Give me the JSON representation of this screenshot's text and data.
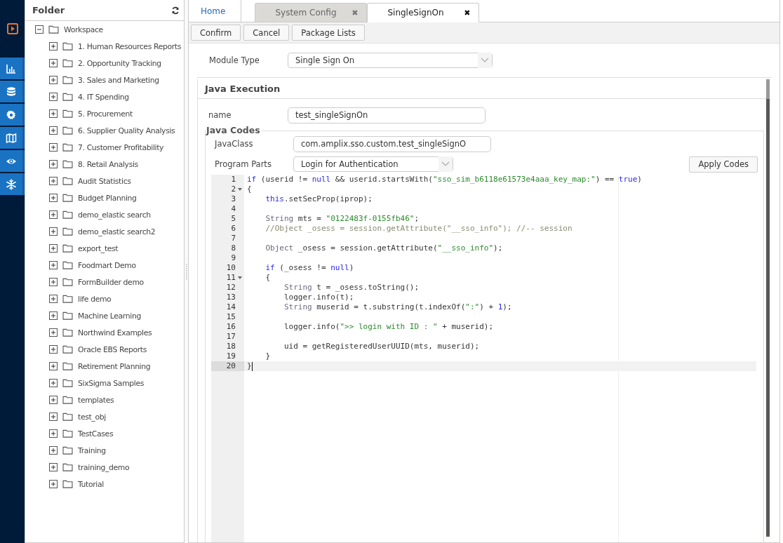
{
  "folder_panel": {
    "title": "Folder",
    "tree": [
      {
        "label": "Workspace",
        "expanded": true,
        "children": [
          {
            "label": "1. Human Resources Reports",
            "expanded": false
          },
          {
            "label": "2. Opportunity Tracking",
            "expanded": false
          },
          {
            "label": "3. Sales and Marketing",
            "expanded": false
          },
          {
            "label": "4. IT Spending",
            "expanded": false
          },
          {
            "label": "5. Procurement",
            "expanded": false
          },
          {
            "label": "6. Supplier Quality Analysis",
            "expanded": false
          },
          {
            "label": "7. Customer Profitability",
            "expanded": false
          },
          {
            "label": "8. Retail Analysis",
            "expanded": false
          },
          {
            "label": "Audit Statistics",
            "expanded": false
          },
          {
            "label": "Budget Planning",
            "expanded": false
          },
          {
            "label": "demo_elastic search",
            "expanded": false
          },
          {
            "label": "demo_elastic search2",
            "expanded": false
          },
          {
            "label": "export_test",
            "expanded": false
          },
          {
            "label": "Foodmart Demo",
            "expanded": false
          },
          {
            "label": "FormBuilder demo",
            "expanded": false
          },
          {
            "label": "life demo",
            "expanded": false
          },
          {
            "label": "Machine Learning",
            "expanded": false
          },
          {
            "label": "Northwind Examples",
            "expanded": false
          },
          {
            "label": "Oracle EBS Reports",
            "expanded": false
          },
          {
            "label": "Retirement Planning",
            "expanded": false
          },
          {
            "label": "SixSigma Samples",
            "expanded": false
          },
          {
            "label": "templates",
            "expanded": false
          },
          {
            "label": "test_obj",
            "expanded": false
          },
          {
            "label": "TestCases",
            "expanded": false
          },
          {
            "label": "Training",
            "expanded": false
          },
          {
            "label": "training_demo",
            "expanded": false
          },
          {
            "label": "Tutorial",
            "expanded": false
          }
        ]
      }
    ]
  },
  "tabs": [
    {
      "label": "Home",
      "kind": "home",
      "selected": false
    },
    {
      "label": "System Config",
      "kind": "closable",
      "selected": false,
      "close": "✖"
    },
    {
      "label": "SingleSignOn",
      "kind": "closable",
      "selected": true,
      "close": "✖"
    }
  ],
  "toolbar": [
    "Confirm",
    "Cancel",
    "Package Lists"
  ],
  "module_type": {
    "label": "Module Type",
    "value": "Single Sign On"
  },
  "java_execution": {
    "title": "Java Execution",
    "name_label": "name",
    "name_value": "test_singleSignOn",
    "java_codes": {
      "legend": "Java Codes",
      "java_class_label": "JavaClass",
      "java_class_value": "com.amplix.sso.custom.test_singleSignO",
      "program_parts_label": "Program Parts",
      "program_parts_value": "Login for Authentication",
      "apply_button": "Apply Codes",
      "editor": {
        "lines": [
          {
            "number": "1",
            "foldable": false,
            "active": false,
            "tokens": [
              {
                "kind": "kw",
                "text": "if"
              },
              {
                "kind": "plain",
                "text": " (userid != "
              },
              {
                "kind": "kw",
                "text": "null"
              },
              {
                "kind": "plain",
                "text": " && userid.startsWith("
              },
              {
                "kind": "str",
                "text": "\"sso_sim_b6118e61573e4aaa_key_map:\""
              },
              {
                "kind": "plain",
                "text": ") == "
              },
              {
                "kind": "kw",
                "text": "true"
              },
              {
                "kind": "plain",
                "text": ")"
              }
            ]
          },
          {
            "number": "2",
            "foldable": true,
            "active": false,
            "tokens": [
              {
                "kind": "plain",
                "text": "{"
              }
            ]
          },
          {
            "number": "3",
            "foldable": false,
            "active": false,
            "tokens": [
              {
                "kind": "kw",
                "text": "    this"
              },
              {
                "kind": "plain",
                "text": ".setSecProp(iprop);"
              }
            ]
          },
          {
            "number": "4",
            "foldable": false,
            "active": false
          },
          {
            "number": "5",
            "foldable": false,
            "active": false,
            "tokens": [
              {
                "kind": "type",
                "text": "    String"
              },
              {
                "kind": "plain",
                "text": " mts = "
              },
              {
                "kind": "str",
                "text": "\"0122483f-0155fb46\""
              },
              {
                "kind": "plain",
                "text": ";"
              }
            ]
          },
          {
            "number": "6",
            "foldable": false,
            "active": false,
            "tokens": [
              {
                "kind": "com",
                "text": "    //Object _osess = session.getAttribute(\"__sso_info\"); //-- session"
              }
            ]
          },
          {
            "number": "7",
            "foldable": false,
            "active": false
          },
          {
            "number": "8",
            "foldable": false,
            "active": false,
            "tokens": [
              {
                "kind": "type",
                "text": "    Object"
              },
              {
                "kind": "plain",
                "text": " _osess = session.getAttribute("
              },
              {
                "kind": "str",
                "text": "\"__sso_info\""
              },
              {
                "kind": "plain",
                "text": ");"
              }
            ]
          },
          {
            "number": "9",
            "foldable": false,
            "active": false
          },
          {
            "number": "10",
            "foldable": false,
            "active": false,
            "tokens": [
              {
                "kind": "kw",
                "text": "    if"
              },
              {
                "kind": "plain",
                "text": " (_osess != "
              },
              {
                "kind": "kw",
                "text": "null"
              },
              {
                "kind": "plain",
                "text": ")"
              }
            ]
          },
          {
            "number": "11",
            "foldable": true,
            "active": false,
            "tokens": [
              {
                "kind": "plain",
                "text": "    {"
              }
            ]
          },
          {
            "number": "12",
            "foldable": false,
            "active": false,
            "tokens": [
              {
                "kind": "type",
                "text": "        String"
              },
              {
                "kind": "plain",
                "text": " t = _osess.toString();"
              }
            ]
          },
          {
            "number": "13",
            "foldable": false,
            "active": false,
            "tokens": [
              {
                "kind": "plain",
                "text": "        logger.info(t);"
              }
            ]
          },
          {
            "number": "14",
            "foldable": false,
            "active": false,
            "tokens": [
              {
                "kind": "type",
                "text": "        String"
              },
              {
                "kind": "plain",
                "text": " muserid = t.substring(t.indexOf("
              },
              {
                "kind": "str",
                "text": "\":\""
              },
              {
                "kind": "plain",
                "text": ") + "
              },
              {
                "kind": "num",
                "text": "1"
              },
              {
                "kind": "plain",
                "text": ");"
              }
            ]
          },
          {
            "number": "15",
            "foldable": false,
            "active": false
          },
          {
            "number": "16",
            "foldable": false,
            "active": false,
            "tokens": [
              {
                "kind": "plain",
                "text": "        logger.info("
              },
              {
                "kind": "str",
                "text": "\">> login with ID : \""
              },
              {
                "kind": "plain",
                "text": " + muserid);"
              }
            ]
          },
          {
            "number": "17",
            "foldable": false,
            "active": false
          },
          {
            "number": "18",
            "foldable": false,
            "active": false,
            "tokens": [
              {
                "kind": "plain",
                "text": "        uid = getRegisteredUserUUID(mts, muserid);"
              }
            ]
          },
          {
            "number": "19",
            "foldable": false,
            "active": false,
            "tokens": [
              {
                "kind": "plain",
                "text": "    }"
              }
            ]
          },
          {
            "number": "20",
            "foldable": false,
            "active": true,
            "tokens": [
              {
                "kind": "plain",
                "text": "}"
              }
            ]
          }
        ]
      }
    }
  }
}
